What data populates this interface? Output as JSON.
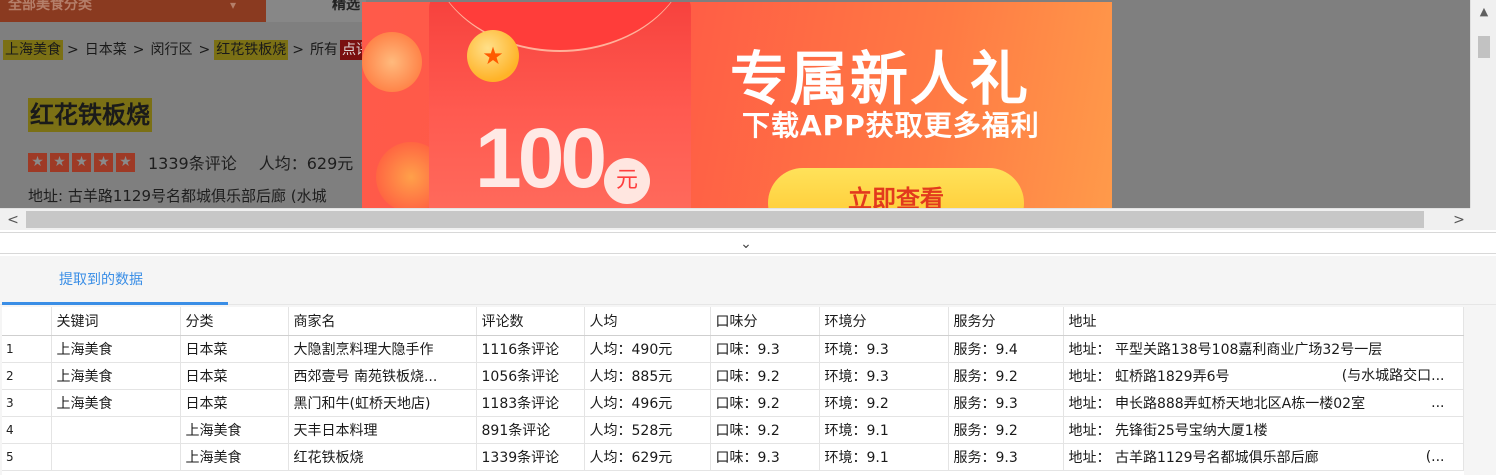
{
  "browser": {
    "category_dropdown": "全部美食分类",
    "category_dropdown_arrow": "▾",
    "next_tab_label": "精选",
    "breadcrumb": {
      "city": "上海美食",
      "cuisine": "日本菜",
      "district": "闵行区",
      "shop": "红花铁板烧",
      "all_prefix": "所有",
      "highlight_tail": "点评"
    },
    "shop": {
      "name": "红花铁板烧",
      "review_count": "1339条评论",
      "avg_price": "人均：629元",
      "address": "地址: 古羊路1129号名都城俱乐部后廊 (水城"
    },
    "star_count": 5,
    "promo": {
      "amount": "100",
      "currency": "元",
      "headline": "专属新人礼",
      "subline": "下载APP获取更多福利",
      "cta": "立即查看",
      "coin_glyph": "★"
    }
  },
  "panel": {
    "tab_label": "提取到的数据",
    "columns": [
      "",
      "关键词",
      "分类",
      "商家名",
      "评论数",
      "人均",
      "口味分",
      "环境分",
      "服务分",
      "地址"
    ],
    "rows": [
      [
        "1",
        "上海美食",
        "日本菜",
        "大隐割烹料理大隐手作",
        "1116条评论",
        "人均：490元",
        "口味：9.3",
        "环境：9.3",
        "服务：9.4",
        "地址：  平型关路138号108嘉利商业广场32号一层",
        ""
      ],
      [
        "2",
        "上海美食",
        "日本菜",
        "西郊壹号 南苑铁板烧...",
        "1056条评论",
        "人均：885元",
        "口味：9.2",
        "环境：9.3",
        "服务：9.2",
        "地址：  虹桥路1829弄6号",
        "(与水城路交口..."
      ],
      [
        "3",
        "上海美食",
        "日本菜",
        "黑门和牛(虹桥天地店)",
        "1183条评论",
        "人均：496元",
        "口味：9.2",
        "环境：9.2",
        "服务：9.3",
        "地址：  申长路888弄虹桥天地北区A栋一楼02室",
        "..."
      ],
      [
        "4",
        "",
        "上海美食",
        "天丰日本料理",
        "891条评论",
        "人均：528元",
        "口味：9.2",
        "环境：9.1",
        "服务：9.2",
        "地址：  先锋街25号宝纳大厦1楼",
        ""
      ],
      [
        "5",
        "",
        "上海美食",
        "红花铁板烧",
        "1339条评论",
        "人均：629元",
        "口味：9.3",
        "环境：9.1",
        "服务：9.3",
        "地址：  古羊路1129号名都城俱乐部后廊",
        "(..."
      ]
    ]
  },
  "icons": {
    "scroll_up": "▲",
    "scroll_left": "<",
    "scroll_right": ">",
    "collapse": "⌄"
  },
  "colors": {
    "accent": "#3a8ee6",
    "promo_red": "#ff5a4a",
    "cta_yellow": "#ffd23a"
  }
}
